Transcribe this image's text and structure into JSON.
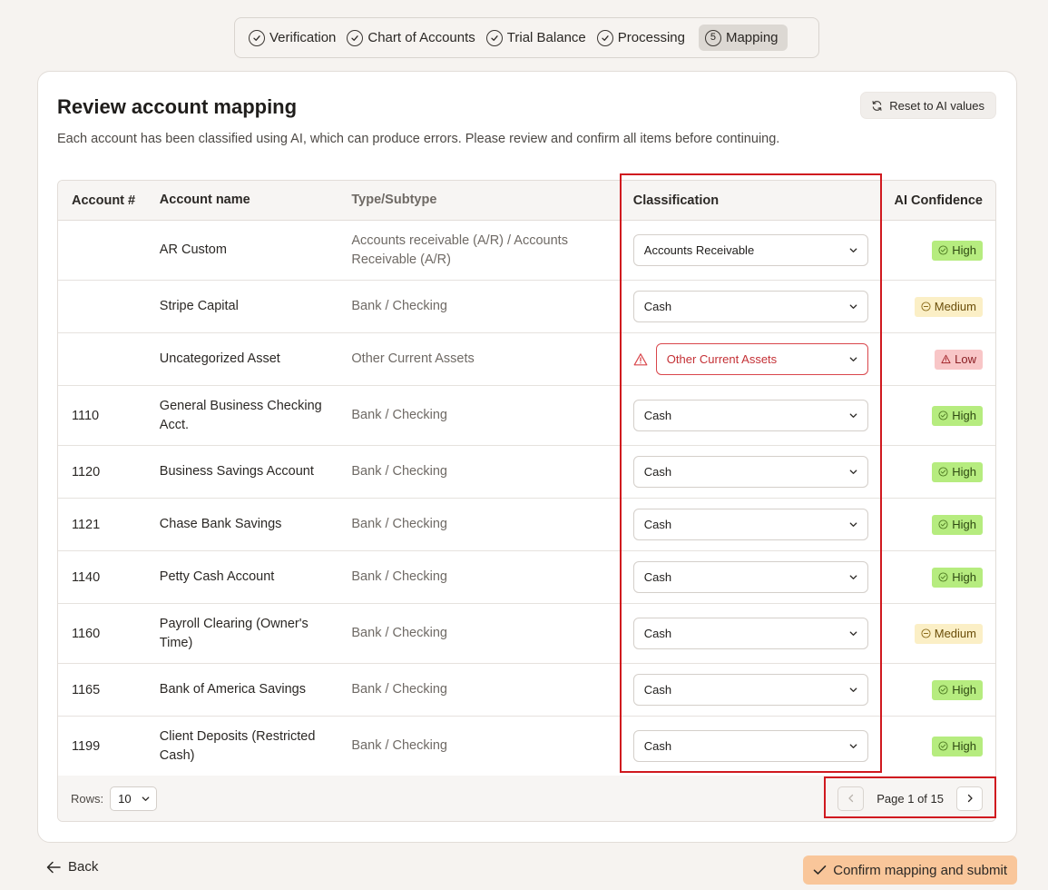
{
  "stepper": {
    "steps": [
      {
        "label": "Verification",
        "state": "done"
      },
      {
        "label": "Chart of Accounts",
        "state": "done"
      },
      {
        "label": "Trial Balance",
        "state": "done"
      },
      {
        "label": "Processing",
        "state": "done"
      },
      {
        "label": "Mapping",
        "state": "active",
        "number": "5"
      }
    ]
  },
  "card": {
    "title": "Review account mapping",
    "description": "Each account has been classified using AI, which can produce errors. Please review and confirm all items before continuing.",
    "reset_label": "Reset to AI values"
  },
  "table": {
    "headers": {
      "number": "Account #",
      "name": "Account name",
      "type": "Type/Subtype",
      "classification": "Classification",
      "confidence": "AI Confidence"
    },
    "rows": [
      {
        "number": "",
        "name": "AR Custom",
        "type": "Accounts receivable (A/R) / Accounts Receivable (A/R)",
        "classification": "Accounts Receivable",
        "confidence": "High",
        "level": "high",
        "error": false
      },
      {
        "number": "",
        "name": "Stripe Capital",
        "type": "Bank / Checking",
        "classification": "Cash",
        "confidence": "Medium",
        "level": "medium",
        "error": false
      },
      {
        "number": "",
        "name": "Uncategorized Asset",
        "type": "Other Current Assets",
        "classification": "Other Current Assets",
        "confidence": "Low",
        "level": "low",
        "error": true
      },
      {
        "number": "1110",
        "name": "General Business Checking Acct.",
        "type": "Bank / Checking",
        "classification": "Cash",
        "confidence": "High",
        "level": "high",
        "error": false
      },
      {
        "number": "1120",
        "name": "Business Savings Account",
        "type": "Bank / Checking",
        "classification": "Cash",
        "confidence": "High",
        "level": "high",
        "error": false
      },
      {
        "number": "1121",
        "name": "Chase Bank Savings",
        "type": "Bank / Checking",
        "classification": "Cash",
        "confidence": "High",
        "level": "high",
        "error": false
      },
      {
        "number": "1140",
        "name": "Petty Cash Account",
        "type": "Bank / Checking",
        "classification": "Cash",
        "confidence": "High",
        "level": "high",
        "error": false
      },
      {
        "number": "1160",
        "name": "Payroll Clearing (Owner's Time)",
        "type": "Bank / Checking",
        "classification": "Cash",
        "confidence": "Medium",
        "level": "medium",
        "error": false
      },
      {
        "number": "1165",
        "name": "Bank of America Savings",
        "type": "Bank / Checking",
        "classification": "Cash",
        "confidence": "High",
        "level": "high",
        "error": false
      },
      {
        "number": "1199",
        "name": "Client Deposits (Restricted Cash)",
        "type": "Bank / Checking",
        "classification": "Cash",
        "confidence": "High",
        "level": "high",
        "error": false
      }
    ],
    "footer": {
      "rows_label": "Rows:",
      "rows_value": "10",
      "page_text": "Page 1 of 15"
    }
  },
  "actions": {
    "back_label": "Back",
    "confirm_label": "Confirm mapping and submit"
  },
  "colors": {
    "accent": "#f9c69a",
    "highlight": "#d0191f",
    "high": "#b6ec7f",
    "medium": "#fbefc6",
    "low": "#f8c6c7"
  }
}
